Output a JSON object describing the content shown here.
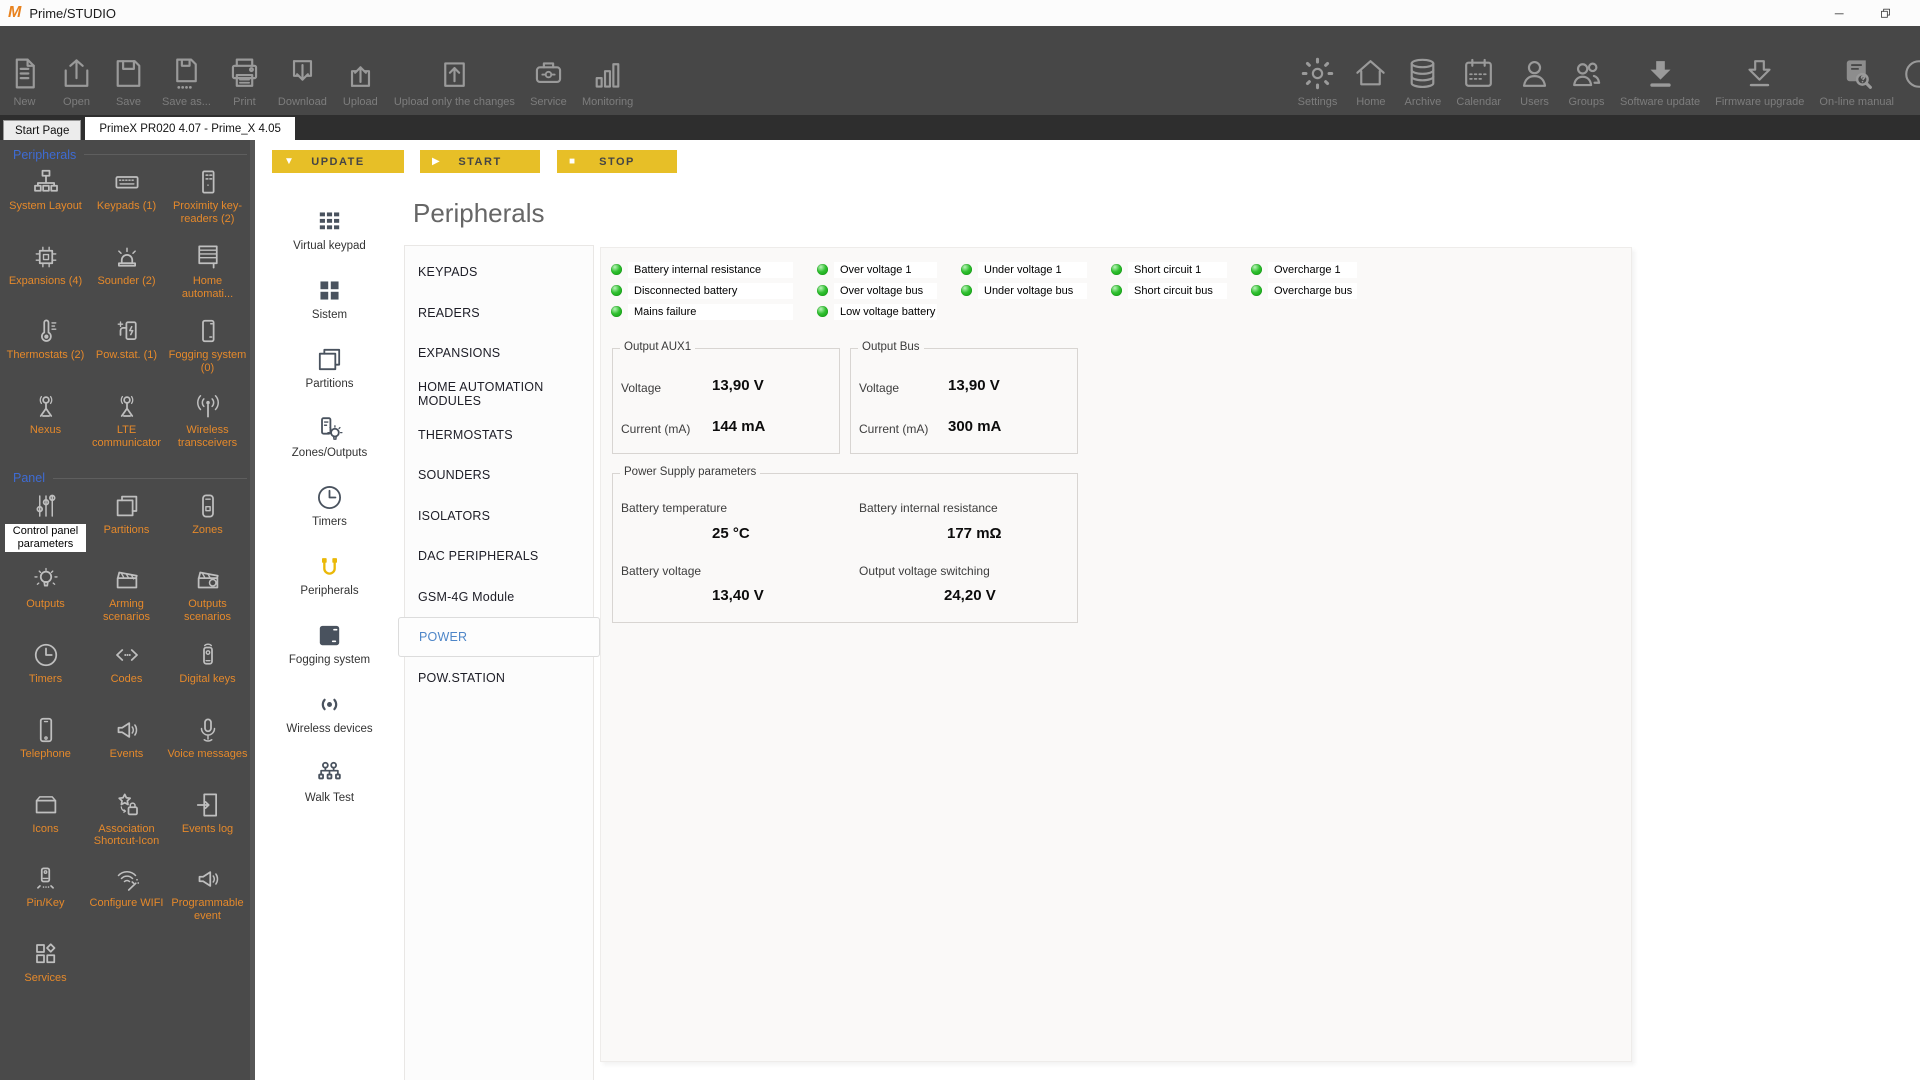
{
  "titlebar": {
    "logo": "M",
    "title": "Prime/STUDIO"
  },
  "toolbar": {
    "left": [
      {
        "label": "New",
        "icon": "file"
      },
      {
        "label": "Open",
        "icon": "open"
      },
      {
        "label": "Save",
        "icon": "floppy"
      },
      {
        "label": "Save as...",
        "icon": "floppy-dots"
      },
      {
        "label": "Print",
        "icon": "printer"
      },
      {
        "label": "Download",
        "icon": "down-box"
      },
      {
        "label": "Upload",
        "icon": "up-box"
      },
      {
        "label": "Upload only the changes",
        "icon": "up-box-changes"
      },
      {
        "label": "Service",
        "icon": "toolbox"
      },
      {
        "label": "Monitoring",
        "icon": "bars"
      }
    ],
    "right": [
      {
        "label": "Settings",
        "icon": "gear"
      },
      {
        "label": "Home",
        "icon": "home"
      },
      {
        "label": "Archive",
        "icon": "database"
      },
      {
        "label": "Calendar",
        "icon": "calendar"
      },
      {
        "label": "Users",
        "icon": "user"
      },
      {
        "label": "Groups",
        "icon": "users"
      },
      {
        "label": "Software update",
        "icon": "down-solid"
      },
      {
        "label": "Firmware upgrade",
        "icon": "down-outline"
      },
      {
        "label": "On-line manual",
        "icon": "manual"
      }
    ],
    "partial_icon": "circle"
  },
  "tabs": [
    {
      "label": "Start Page",
      "active": false
    },
    {
      "label": "PrimeX PR020 4.07 - Prime_X 4.05",
      "active": true
    }
  ],
  "sidebar": {
    "sections": [
      {
        "title": "Peripherals",
        "items": [
          {
            "label": "System Layout",
            "icon": "tree"
          },
          {
            "label": "Keypads (1)",
            "icon": "keyboard"
          },
          {
            "label": "Proximity key-readers (2)",
            "icon": "reader"
          },
          {
            "label": "Expansions (4)",
            "icon": "chip"
          },
          {
            "label": "Sounder (2)",
            "icon": "siren"
          },
          {
            "label": "Home automati...",
            "icon": "blinds"
          },
          {
            "label": "Thermostats (2)",
            "icon": "thermometer"
          },
          {
            "label": "Pow.stat. (1)",
            "icon": "power-station"
          },
          {
            "label": "Fogging system (0)",
            "icon": "fogging"
          },
          {
            "label": "Nexus",
            "icon": "antenna"
          },
          {
            "label": "LTE communicator",
            "icon": "antenna"
          },
          {
            "label": "Wireless transceivers",
            "icon": "wireless"
          }
        ]
      },
      {
        "title": "Panel",
        "items": [
          {
            "label": "Control panel parameters",
            "icon": "sliders",
            "highlight": true
          },
          {
            "label": "Partitions",
            "icon": "partitions"
          },
          {
            "label": "Zones",
            "icon": "detector"
          },
          {
            "label": "Outputs",
            "icon": "bulb"
          },
          {
            "label": "Arming scenarios",
            "icon": "clapper"
          },
          {
            "label": "Outputs scenarios",
            "icon": "clapper-bulb"
          },
          {
            "label": "Timers",
            "icon": "clock"
          },
          {
            "label": "Codes",
            "icon": "codes"
          },
          {
            "label": "Digital keys",
            "icon": "key-fob"
          },
          {
            "label": "Telephone",
            "icon": "phone"
          },
          {
            "label": "Events",
            "icon": "megaphone"
          },
          {
            "label": "Voice messages",
            "icon": "microphone"
          },
          {
            "label": "Icons",
            "icon": "box"
          },
          {
            "label": "Association Shortcut-Icon",
            "icon": "star-lock"
          },
          {
            "label": "Events log",
            "icon": "exit-door"
          },
          {
            "label": "Pin/Key",
            "icon": "pin-key"
          },
          {
            "label": "Configure WIFI",
            "icon": "wifi-wand"
          },
          {
            "label": "Programmable event",
            "icon": "megaphone"
          },
          {
            "label": "Services",
            "icon": "services"
          }
        ]
      }
    ]
  },
  "nav": [
    {
      "label": "Virtual keypad",
      "icon": "grid9"
    },
    {
      "label": "Sistem",
      "icon": "grid4"
    },
    {
      "label": "Partitions",
      "icon": "partitions"
    },
    {
      "label": "Zones/Outputs",
      "icon": "zones-bulb"
    },
    {
      "label": "Timers",
      "icon": "clock"
    },
    {
      "label": "Peripherals",
      "icon": "peri-wire",
      "active": true
    },
    {
      "label": "Fogging system",
      "icon": "fog-dark"
    },
    {
      "label": "Wireless devices",
      "icon": "wireless-dot"
    },
    {
      "label": "Walk Test",
      "icon": "walk-test"
    }
  ],
  "actions": [
    {
      "label": "UPDATE",
      "symbol": "▼"
    },
    {
      "label": "START",
      "symbol": "▶"
    },
    {
      "label": "STOP",
      "symbol": "■"
    }
  ],
  "page": {
    "title": "Peripherals"
  },
  "submenu": [
    {
      "label": "KEYPADS"
    },
    {
      "label": "READERS"
    },
    {
      "label": "EXPANSIONS"
    },
    {
      "label": "HOME AUTOMATION MODULES"
    },
    {
      "label": "THERMOSTATS"
    },
    {
      "label": "SOUNDERS"
    },
    {
      "label": "ISOLATORS"
    },
    {
      "label": "DAC PERIPHERALS"
    },
    {
      "label": "GSM-4G Module"
    },
    {
      "label": "POWER",
      "active": true
    },
    {
      "label": "POW.STATION"
    }
  ],
  "indicators": [
    "Battery internal resistance",
    "Over voltage 1",
    "Under voltage 1",
    "Short circuit 1",
    "Overcharge 1",
    "Disconnected battery",
    "Over voltage bus",
    "Under voltage bus",
    "Short circuit bus",
    "Overcharge bus",
    "Mains failure",
    "Low voltage battery"
  ],
  "groups": {
    "aux1": {
      "title": "Output AUX1",
      "rows": [
        {
          "label": "Voltage",
          "value": "13,90 V"
        },
        {
          "label": "Current (mA)",
          "value": "144 mA"
        }
      ]
    },
    "bus": {
      "title": "Output Bus",
      "rows": [
        {
          "label": "Voltage",
          "value": "13,90 V"
        },
        {
          "label": "Current (mA)",
          "value": "300 mA"
        }
      ]
    },
    "psu": {
      "title": "Power Supply parameters",
      "params": [
        {
          "label": "Battery temperature",
          "value": "25 °C"
        },
        {
          "label": "Battery internal resistance",
          "value": "177 mΩ"
        },
        {
          "label": "Battery voltage",
          "value": "13,40 V"
        },
        {
          "label": "Output voltage switching",
          "value": "24,20 V"
        }
      ]
    }
  },
  "colors": {
    "toolbar_bg": "#474747",
    "sidebar_bg": "#4a4a4a",
    "accent_yellow": "#e7bf27",
    "orange_label": "#e5892b",
    "section_blue": "#3e6bd3",
    "selected_blue": "#4e86c8",
    "led_green": "#30c030",
    "nav_active_gold": "#eab808"
  }
}
